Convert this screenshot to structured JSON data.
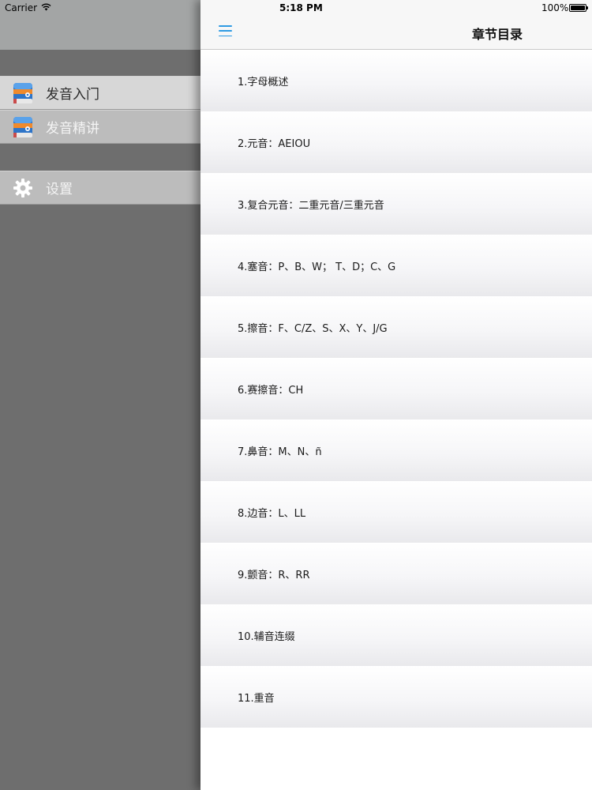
{
  "status_bar": {
    "carrier": "Carrier",
    "time": "5:18 PM",
    "battery_text": "100%",
    "battery_level": 1.0
  },
  "sidebar": {
    "items": [
      {
        "label": "发音入门",
        "icon": "book-icon",
        "selected": true
      },
      {
        "label": "发音精讲",
        "icon": "book-icon",
        "selected": false
      },
      {
        "label": "设置",
        "icon": "gear-icon",
        "selected": false
      }
    ]
  },
  "navbar": {
    "title": "章节目录",
    "menu_icon": "hamburger-menu-icon",
    "accent_color": "#2f9be3"
  },
  "chapters": [
    "1.字母概述",
    "2.元音：AEIOU",
    "3.复合元音：二重元音/三重元音",
    "4.塞音：P、B、W； T、D；C、G",
    "5.擦音：F、C/Z、S、X、Y、J/G",
    "6.赛擦音：CH",
    "7.鼻音：M、N、ñ",
    "8.边音：L、LL",
    "9.颤音：R、RR",
    "10.辅音连缀",
    "11.重音"
  ]
}
